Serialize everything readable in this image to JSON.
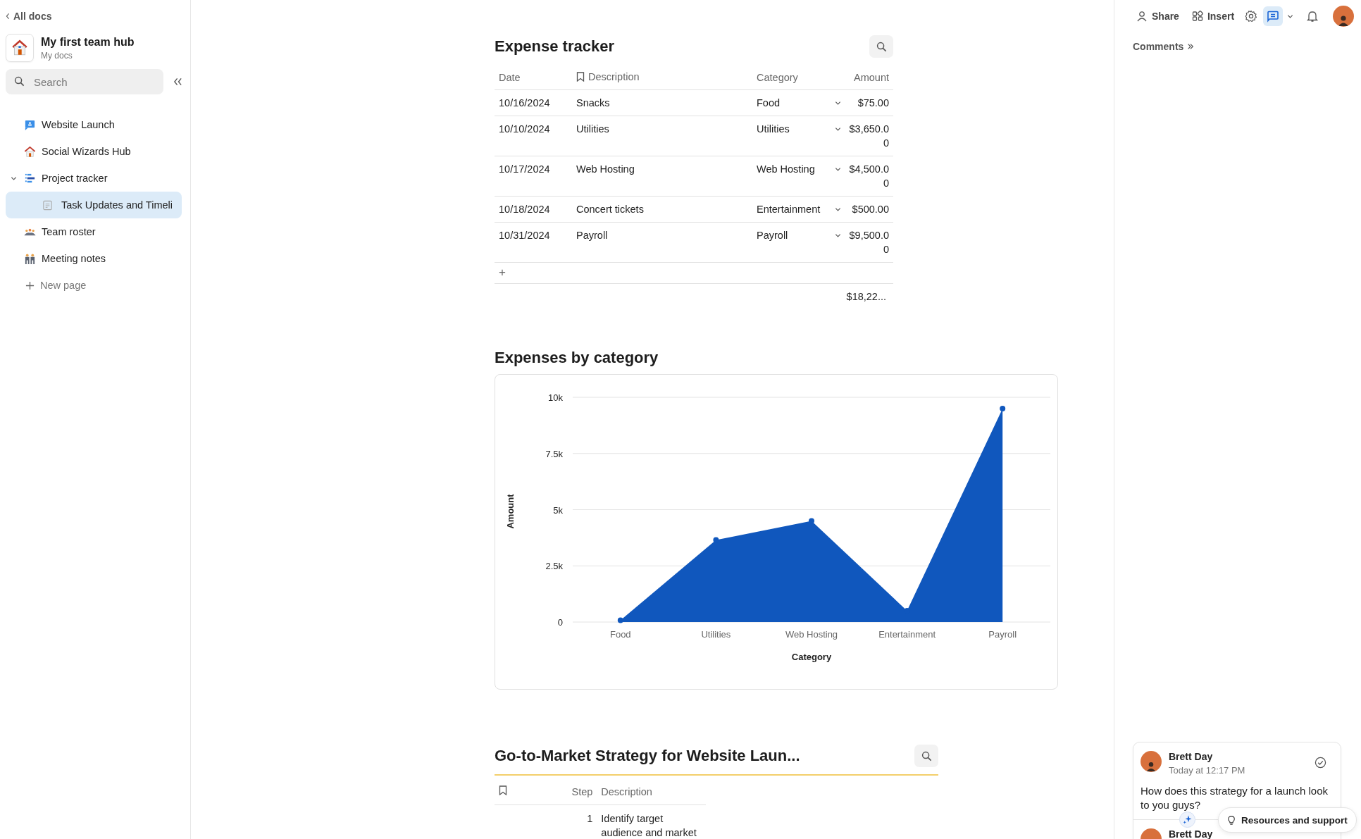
{
  "sidebar": {
    "back_link": "All docs",
    "hub": {
      "title": "My first team hub",
      "subtitle": "My docs"
    },
    "search": {
      "placeholder": "Search"
    },
    "items": [
      {
        "label": "Website Launch",
        "selected": false
      },
      {
        "label": "Social Wizards Hub",
        "selected": false
      },
      {
        "label": "Project tracker",
        "selected": false,
        "expanded": true,
        "children": [
          {
            "label": "Task Updates and Timeli",
            "selected": true
          }
        ]
      },
      {
        "label": "Team roster",
        "selected": false
      },
      {
        "label": "Meeting notes",
        "selected": false
      }
    ],
    "new_page": {
      "label": "New page"
    }
  },
  "expense_table": {
    "title": "Expense tracker",
    "columns": [
      {
        "label": "Date",
        "kind": "date"
      },
      {
        "label": "Description",
        "kind": "title"
      },
      {
        "label": "Category",
        "kind": "select"
      },
      {
        "label": "Amount",
        "kind": "currency"
      }
    ],
    "rows": [
      {
        "cells": [
          "10/16/2024",
          "Snacks",
          "Food",
          "$75.00"
        ]
      },
      {
        "cells": [
          "10/10/2024",
          "Utilities",
          "Utilities",
          "$3,650.00"
        ]
      },
      {
        "cells": [
          "10/17/2024",
          "Web Hosting",
          "Web Hosting",
          "$4,500.00"
        ]
      },
      {
        "cells": [
          "10/18/2024",
          "Concert tickets",
          "Entertainment",
          "$500.00"
        ]
      },
      {
        "cells": [
          "10/31/2024",
          "Payroll",
          "Payroll",
          "$9,500.00"
        ]
      }
    ],
    "add_row": "+",
    "total": "$18,22..."
  },
  "chart_section": {
    "title": "Expenses by category",
    "chart_data": {
      "type": "area",
      "xlabel": "Category",
      "ylabel": "Amount",
      "categories": [
        "Food",
        "Utilities",
        "Web Hosting",
        "Entertainment",
        "Payroll"
      ],
      "series": [
        {
          "color": "#1057bd",
          "values": [
            75,
            3650,
            4500,
            500,
            9500
          ]
        }
      ],
      "grid": true,
      "ylim": [
        0,
        10000
      ],
      "yticks": [
        {
          "value": 0,
          "label": "0"
        },
        {
          "value": 2500,
          "label": "2.5k"
        },
        {
          "value": 5000,
          "label": "5k"
        },
        {
          "value": 7500,
          "label": "7.5k"
        },
        {
          "value": 10000,
          "label": "10k"
        }
      ]
    }
  },
  "strategy_table": {
    "title": "Go-to-Market Strategy for Website Laun...",
    "highlighted": true,
    "columns": [
      {
        "label": "Step"
      },
      {
        "label": "Description"
      }
    ],
    "rows": [
      {
        "step": "1",
        "description": "Identify target audience and market"
      }
    ]
  },
  "top_bar": {
    "buttons": [
      {
        "label": "Share"
      },
      {
        "label": "Insert"
      }
    ],
    "comments_toggle": {
      "on": true
    }
  },
  "comments_panel": {
    "title": "Comments",
    "comments": [
      {
        "author": "Brett Day",
        "time": "Today at 12:17 PM",
        "text": "How does this strategy for a launch look to you guys?"
      },
      {
        "author": "Brett Day"
      }
    ]
  },
  "resources_button": "Resources and support"
}
